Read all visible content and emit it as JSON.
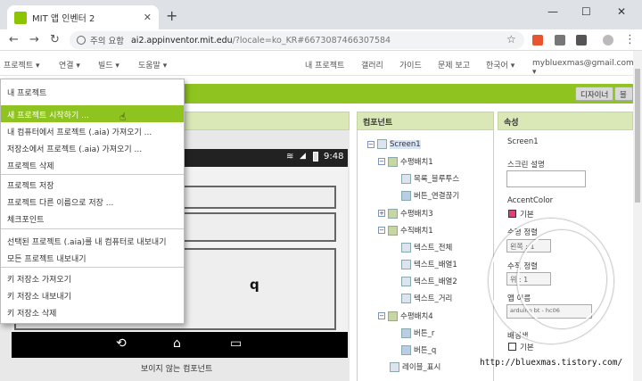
{
  "browser": {
    "tab_title": "MIT 앱 인벤터 2",
    "tab_close": "✕",
    "new_tab": "+",
    "win_minimize": "—",
    "win_maximize": "☐",
    "win_close": "✕",
    "back": "←",
    "forward": "→",
    "reload": "↻",
    "security_label": "주의 요함",
    "url_host": "ai2.appinventor.mit.edu",
    "url_path": "/?locale=ko_KR#6673087466307584",
    "star": "☆",
    "menu_dots": "⋮"
  },
  "topmenu": {
    "project": "프로젝트 ▾",
    "connect": "연결 ▾",
    "build": "빌드 ▾",
    "help": "도움말 ▾",
    "my_projects": "내 프로젝트",
    "gallery": "갤러리",
    "guide": "가이드",
    "report": "문제 보고",
    "language": "한국어 ▾",
    "account": "mybluexmas@gmail.com ▾"
  },
  "toolbar": {
    "designer": "디자이너",
    "blocks": "블록"
  },
  "columns": {
    "components": "컴포넌트",
    "properties": "속성"
  },
  "phone": {
    "time": "9:48",
    "q_label": "q",
    "nav_back": "⟲",
    "nav_home": "⌂",
    "nav_recent": "▭"
  },
  "viewer": {
    "nonvisible": "보이지 않는 컴포넌트"
  },
  "tree": {
    "screen": "Screen1",
    "items": [
      {
        "toggle": "⊟",
        "label": "수평배치1"
      },
      {
        "label": "목록_블루투스"
      },
      {
        "label": "버튼_연결끊기"
      },
      {
        "toggle": "⊞",
        "label": "수평배치3"
      },
      {
        "toggle": "⊟",
        "label": "수직배치1"
      },
      {
        "label": "텍스트_전체"
      },
      {
        "label": "텍스트_배열1"
      },
      {
        "label": "텍스트_배열2"
      },
      {
        "label": "텍스트_거리"
      },
      {
        "toggle": "⊟",
        "label": "수평배치4"
      },
      {
        "label": "버튼_r"
      },
      {
        "label": "버튼_q"
      },
      {
        "label": "레이블_표시"
      }
    ]
  },
  "properties": {
    "title": "Screen1",
    "desc_label": "스크린 설명",
    "accent_label": "AccentColor",
    "accent_value": "기본",
    "accent_color": "#e0407a",
    "align_h_label": "수평 정렬",
    "align_h_value": "왼쪽 : 1",
    "align_v_label": "수직 정렬",
    "align_v_value": "위 : 1",
    "appname_label": "앱 이름",
    "appname_value": "arduino bt - hc06",
    "bg_label": "배경색",
    "bg_value": "기본"
  },
  "dropdown": {
    "items": [
      "내 프로젝트",
      "새 프로젝트 시작하기 ...",
      "내 컴퓨터에서 프로젝트 (.aia) 가져오기 ...",
      "저장소에서 프로젝트 (.aia) 가져오기 ...",
      "프로젝트 삭제",
      "프로젝트 저장",
      "프로젝트 다른 이름으로 저장 ...",
      "체크포인트",
      "선택된 프로젝트 (.aia)를 내 컴퓨터로 내보내기",
      "모든 프로젝트 내보내기",
      "키 저장소 가져오기",
      "키 저장소 내보내기",
      "키 저장소 삭제"
    ]
  },
  "watermark": {
    "url": "http://bluexmas.tistory.com/"
  },
  "colors": {
    "accent_green": "#8fc31f",
    "header_green": "#d9e8b6"
  }
}
